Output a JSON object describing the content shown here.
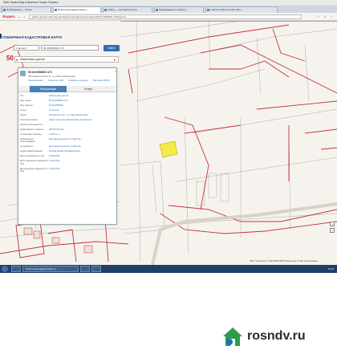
{
  "browser": {
    "menu_text": "Файл   Правка   Вид   Избранное   Сервис   Справка",
    "tabs": [
      {
        "label": "(1) Входящие — Почта",
        "active": false
      },
      {
        "label": "Публичная кадастровая к...",
        "active": true
      },
      {
        "label": "Сайты — частный участок",
        "active": false
      },
      {
        "label": "Информация по объекту",
        "active": false
      },
      {
        "label": "Участок 0.60 га в СНТ «Лес...",
        "active": false
      }
    ],
    "logo": "Яндекс",
    "address": "pkk5.rosreestr.ru/#x=&y=&z=&app=search&opened=1&text=50:26:0060601:173&type=1",
    "nav_icons": "← →",
    "toolbar_icons": "☆ ≡ –"
  },
  "pkk": {
    "title": "ПУБЛИЧНАЯ КАДАСТРОВАЯ КАРТА",
    "search_type": "Участки ▾",
    "search_value": "50:26:0060601:173",
    "search_button": "Найти",
    "map_label_left": "50",
    "panel_header": "Земельные участки"
  },
  "card": {
    "number": "50:26:0060601:173",
    "address": "Московская область, р-н Наро-Фоминский",
    "links": [
      "Уведомления",
      "Перейти к МБ",
      "Показать на карте",
      "Выписка ЕГРН"
    ],
    "tabs": [
      "Информация",
      "Услуги"
    ],
    "rows": [
      {
        "k": "Тип",
        "v": "Земельный участок"
      },
      {
        "k": "Кад. номер",
        "v": "50:26:0060601:173"
      },
      {
        "k": "Кад. квартал",
        "v": "50:26:0060601"
      },
      {
        "k": "Статус",
        "v": "Учтенный"
      },
      {
        "k": "Адрес",
        "v": "Московская обл., р-н Наро-Фоминский"
      },
      {
        "k": "Категория земель",
        "v": "Земли сельскохозяйственного назначения"
      },
      {
        "k": "Форма собственности",
        "v": ""
      },
      {
        "k": "Кадастровая стоимость",
        "v": "206 874,00 руб."
      },
      {
        "k": "Уточненная площадь",
        "v": "6 000 кв. м"
      },
      {
        "k": "Разрешенное использование",
        "v": "Для ведения дачного хозяйства"
      },
      {
        "k": "по документу",
        "v": "Для ведения дачного хозяйства"
      },
      {
        "k": "Кадастровый инженер",
        "v": "Беляев Михаил Владимирович"
      },
      {
        "k": "Дата постановки на учет",
        "v": "12.09.2011"
      },
      {
        "k": "Дата изменения сведений в ГКН",
        "v": "12.09.2011"
      },
      {
        "k": "Дата выгрузки сведений из ГКН",
        "v": "12.09.2011"
      }
    ]
  },
  "map": {
    "labels": [
      {
        "text": "50",
        "cls": "big"
      },
      {
        "text": "ЗЕМЛИ",
        "cls": "small"
      },
      {
        "text": "ЗЕМЛИ",
        "cls": "small"
      },
      {
        "text": "ЗЕМЛИ",
        "cls": "small"
      }
    ],
    "status_text": "ПКК © Росреестр   © 2016   ФГБУ ФКП Росреестра   © ОАО «Ростелеком»",
    "zoom_in": "+",
    "zoom_out": "−",
    "highlight_color": "#f5e94a",
    "parcel_line_color": "#c8323c",
    "thin_line_color": "#8a8a8a"
  },
  "taskbar": {
    "items": [
      "",
      "Публичная кадастровая пр...",
      "",
      ""
    ],
    "clock": "14:42"
  },
  "watermark": {
    "text": "rosndv.ru"
  }
}
